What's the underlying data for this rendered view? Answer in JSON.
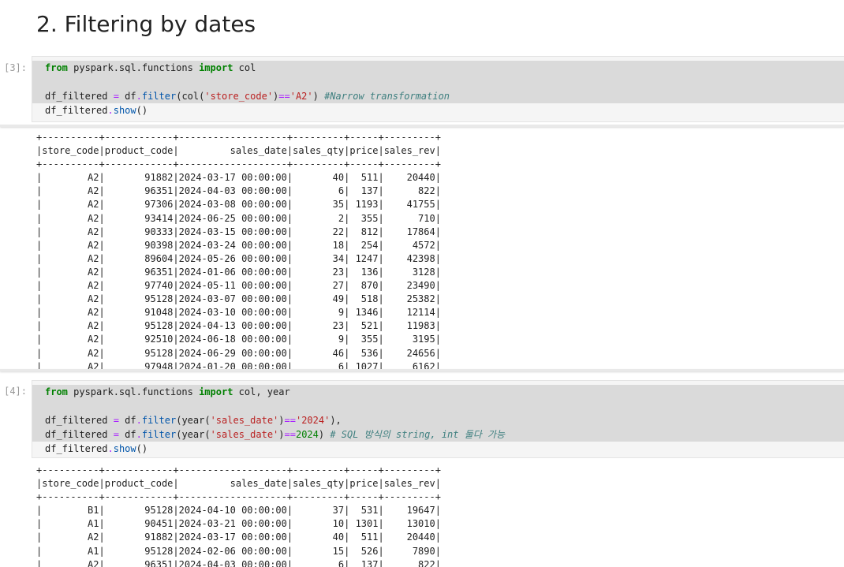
{
  "heading": "2. Filtering by dates",
  "cells": [
    {
      "prompt": "[3]:",
      "code_lines": [
        "from pyspark.sql.functions import col",
        "",
        "df_filtered = df.filter(col('store_code')=='A2') #Narrow transformation",
        "df_filtered.show()"
      ],
      "output_lines": [
        "+----------+------------+-------------------+---------+-----+---------+",
        "|store_code|product_code|         sales_date|sales_qty|price|sales_rev|",
        "+----------+------------+-------------------+---------+-----+---------+",
        "|        A2|       91882|2024-03-17 00:00:00|       40|  511|    20440|",
        "|        A2|       96351|2024-04-03 00:00:00|        6|  137|      822|",
        "|        A2|       97306|2024-03-08 00:00:00|       35| 1193|    41755|",
        "|        A2|       93414|2024-06-25 00:00:00|        2|  355|      710|",
        "|        A2|       90333|2024-03-15 00:00:00|       22|  812|    17864|",
        "|        A2|       90398|2024-03-24 00:00:00|       18|  254|     4572|",
        "|        A2|       89604|2024-05-26 00:00:00|       34| 1247|    42398|",
        "|        A2|       96351|2024-01-06 00:00:00|       23|  136|     3128|",
        "|        A2|       97740|2024-05-11 00:00:00|       27|  870|    23490|",
        "|        A2|       95128|2024-03-07 00:00:00|       49|  518|    25382|",
        "|        A2|       91048|2024-03-10 00:00:00|        9| 1346|    12114|",
        "|        A2|       95128|2024-04-13 00:00:00|       23|  521|    11983|",
        "|        A2|       92510|2024-06-18 00:00:00|        9|  355|     3195|",
        "|        A2|       95128|2024-06-29 00:00:00|       46|  536|    24656|",
        "|        A2|       97948|2024-01-20 00:00:00|        6| 1027|     6162|"
      ]
    },
    {
      "prompt": "[4]:",
      "code_lines": [
        "from pyspark.sql.functions import col, year",
        "",
        "df_filtered = df.filter(year('sales_date')=='2024'),",
        "df_filtered = df.filter(year('sales_date')==2024) # SQL 방식의 string, int 둘다 가능",
        "df_filtered.show()"
      ],
      "output_lines": [
        "+----------+------------+-------------------+---------+-----+---------+",
        "|store_code|product_code|         sales_date|sales_qty|price|sales_rev|",
        "+----------+------------+-------------------+---------+-----+---------+",
        "|        B1|       95128|2024-04-10 00:00:00|       37|  531|    19647|",
        "|        A1|       90451|2024-03-21 00:00:00|       10| 1301|    13010|",
        "|        A2|       91882|2024-03-17 00:00:00|       40|  511|    20440|",
        "|        A1|       95128|2024-02-06 00:00:00|       15|  526|     7890|",
        "|        A2|       96351|2024-04-03 00:00:00|        6|  137|      822|"
      ]
    }
  ]
}
